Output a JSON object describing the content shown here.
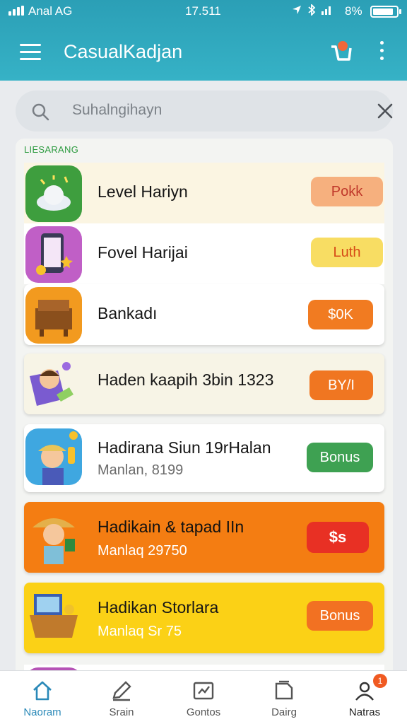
{
  "status_bar": {
    "carrier": "Anal AG",
    "time": "17.511",
    "battery": "8%"
  },
  "app_bar": {
    "title": "CasualKadjan"
  },
  "search": {
    "placeholder": "Suhalngihayn"
  },
  "list": {
    "section_label": "LIESARANG",
    "items": [
      {
        "title": "Level Hariyn",
        "badge": "Pokk",
        "badge_color": "#f6b07e"
      },
      {
        "title": "Fovel Harijai",
        "badge": "Luth",
        "badge_color": "#f8dd63"
      },
      {
        "title": "Bankadı",
        "badge": "$0K",
        "badge_color": "#f17b21"
      },
      {
        "title": "Haden kaapih 3bin 1323",
        "badge": "BY/I",
        "badge_color": "#f07621"
      },
      {
        "title": "Hadirana Siun 19rHalan",
        "subtitle": "Manlan, 8199",
        "badge": "Bonus",
        "badge_color": "#3ea152"
      },
      {
        "title": "Hadikain & tapad IIn",
        "subtitle": "Manlaq 29750",
        "badge": "$s",
        "badge_color": "#e83024"
      },
      {
        "title": "Hadikan Storlara",
        "subtitle": "Manlaq Sr 75",
        "badge": "Bonus",
        "badge_color": "#f27122"
      }
    ]
  },
  "bottom_nav": {
    "items": [
      {
        "label": "Naoram",
        "icon": "home-icon"
      },
      {
        "label": "Srain",
        "icon": "edit-icon"
      },
      {
        "label": "Gontos",
        "icon": "photo-edit-icon"
      },
      {
        "label": "Dairg",
        "icon": "document-icon"
      },
      {
        "label": "Natras",
        "icon": "profile-icon",
        "notification": "1"
      }
    ]
  }
}
